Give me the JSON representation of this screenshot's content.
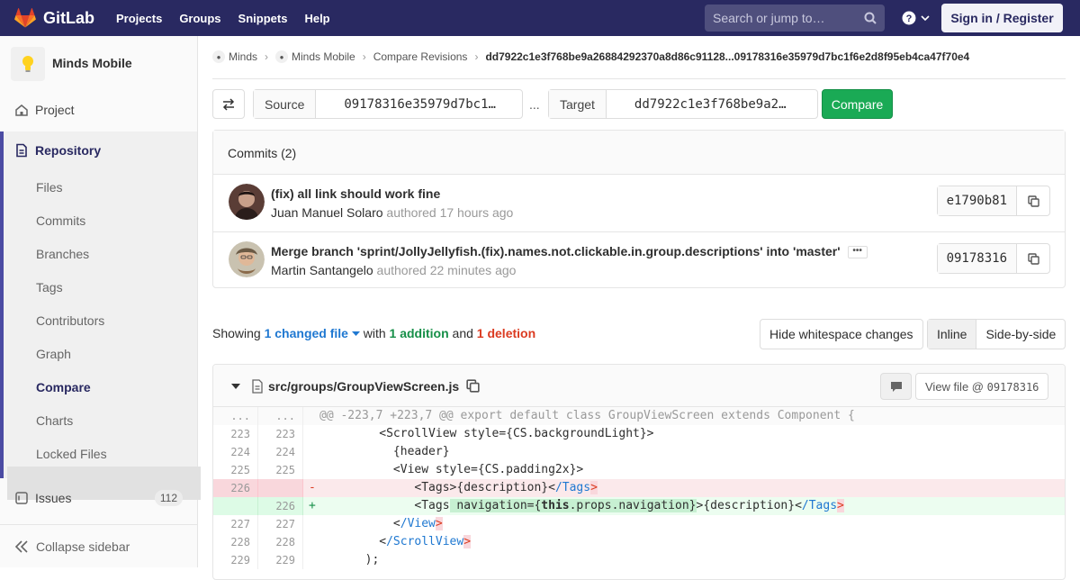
{
  "topnav": {
    "brand": "GitLab",
    "links": [
      "Projects",
      "Groups",
      "Snippets",
      "Help"
    ],
    "search_placeholder": "Search or jump to…",
    "signin": "Sign in / Register",
    "colors": {
      "bar": "#292961",
      "accent": "#fc6d26"
    }
  },
  "sidebar": {
    "project_name": "Minds Mobile",
    "project": "Project",
    "repository": "Repository",
    "repo_items": [
      "Files",
      "Commits",
      "Branches",
      "Tags",
      "Contributors",
      "Graph",
      "Compare",
      "Charts",
      "Locked Files"
    ],
    "active_item": "Compare",
    "issues": "Issues",
    "issues_count": "112",
    "collapse": "Collapse sidebar"
  },
  "breadcrumb": {
    "items": [
      "Minds",
      "Minds Mobile",
      "Compare Revisions"
    ],
    "current": "dd7922c1e3f768be9a26884292370a8d86c91128...09178316e35979d7bc1f6e2d8f95eb4ca47f70e4"
  },
  "compare": {
    "source_label": "Source",
    "source_value": "09178316e35979d7bc1…",
    "separator": "...",
    "target_label": "Target",
    "target_value": "dd7922c1e3f768be9a2…",
    "button": "Compare"
  },
  "commits": {
    "header": "Commits (2)",
    "items": [
      {
        "title": "(fix) all link should work fine",
        "author": "Juan Manuel Solaro",
        "verb": "authored",
        "time": "17 hours ago",
        "sha": "e1790b81"
      },
      {
        "title": "Merge branch 'sprint/JollyJellyfish.(fix).names.not.clickable.in.group.descriptions' into 'master'",
        "author": "Martin Santangelo",
        "verb": "authored",
        "time": "22 minutes ago",
        "sha": "09178316"
      }
    ]
  },
  "summary": {
    "showing": "Showing",
    "changed": "1 changed file",
    "with": "with",
    "additions": "1 addition",
    "and": "and",
    "deletions": "1 deletion",
    "hide_ws": "Hide whitespace changes",
    "inline": "Inline",
    "side_by_side": "Side-by-side"
  },
  "file": {
    "path": "src/groups/GroupViewScreen.js",
    "view_file": "View file @ ",
    "view_sha": "09178316",
    "hunk": "@@ -223,7 +223,7 @@ export default class GroupViewScreen extends Component {",
    "lines": [
      {
        "old": "223",
        "new": "223",
        "text": "          <ScrollView style={CS.backgroundLight}>"
      },
      {
        "old": "224",
        "new": "224",
        "text": "            {header}"
      },
      {
        "old": "225",
        "new": "225",
        "text": "            <View style={CS.padding2x}>"
      }
    ]
  }
}
